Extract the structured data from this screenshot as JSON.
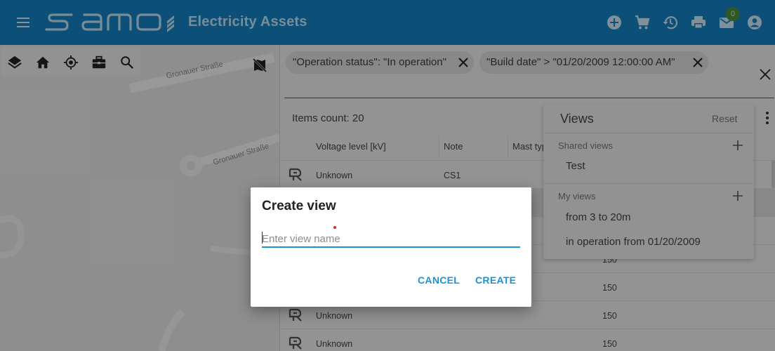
{
  "header": {
    "app_title": "Electricity Assets",
    "mail_badge": "0",
    "icons": [
      "menu-icon",
      "add-circle-icon",
      "cart-icon",
      "history-icon",
      "print-icon",
      "mail-icon",
      "account-icon"
    ]
  },
  "map": {
    "toolbar_icons": [
      "layers-icon",
      "home-icon",
      "crosshair-icon",
      "briefcase-icon",
      "search-icon"
    ],
    "streets": [
      "Gronauer Straße",
      "Gronauer Straße"
    ],
    "toggle_icon": "map-off-icon"
  },
  "filters": [
    {
      "label": "\"Operation status\": \"In operation\""
    },
    {
      "label": "\"Build date\" > \"01/20/2009 12:00:00 AM\""
    }
  ],
  "list": {
    "items_count": "Items count: 20",
    "columns": [
      "Voltage level [kV]",
      "Note",
      "Mast typ"
    ],
    "rows": [
      {
        "voltage": "Unknown",
        "note": "CS1",
        "value": ""
      },
      {
        "voltage": "",
        "note": "",
        "value": ""
      },
      {
        "voltage": "",
        "note": "",
        "value": ""
      },
      {
        "voltage": "",
        "note": "",
        "value": "150"
      },
      {
        "voltage": "",
        "note": "",
        "value": "150"
      },
      {
        "voltage": "Unknown",
        "note": "",
        "value": "150"
      },
      {
        "voltage": "Unknown",
        "note": "",
        "value": "150"
      }
    ]
  },
  "views": {
    "title": "Views",
    "reset": "Reset",
    "shared_label": "Shared views",
    "shared_items": [
      "Test"
    ],
    "my_label": "My views",
    "my_items": [
      "from 3 to 20m",
      "in operation from 01/20/2009"
    ]
  },
  "dialog": {
    "title": "Create view",
    "placeholder": "Enter view name",
    "value": "",
    "cancel": "CANCEL",
    "create": "CREATE"
  },
  "colors": {
    "header": "#1481c4",
    "accent": "#1895d5"
  }
}
